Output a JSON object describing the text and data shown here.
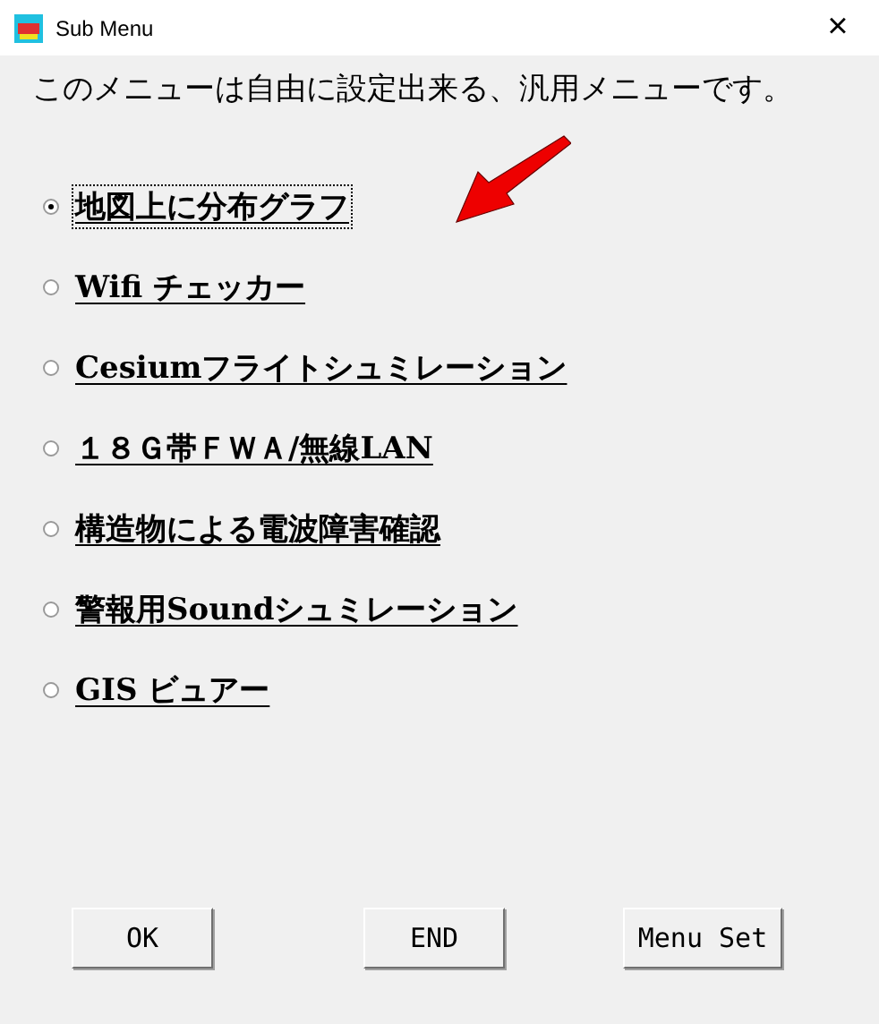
{
  "window": {
    "title": "Sub Menu",
    "close": "×"
  },
  "intro": "このメニューは自由に設定出来る、汎用メニューです。",
  "options": [
    {
      "label": "地図上に分布グラフ",
      "selected": true
    },
    {
      "label": "Wifi チェッカー",
      "selected": false
    },
    {
      "label": "Cesiumフライトシュミレーション",
      "selected": false
    },
    {
      "label": "１８Ｇ帯ＦＷＡ/無線LAN",
      "selected": false
    },
    {
      "label": "構造物による電波障害確認",
      "selected": false
    },
    {
      "label": "警報用Soundシュミレーション",
      "selected": false
    },
    {
      "label": "GIS ビュアー",
      "selected": false
    }
  ],
  "buttons": [
    "OK",
    "END",
    "Menu Set"
  ]
}
